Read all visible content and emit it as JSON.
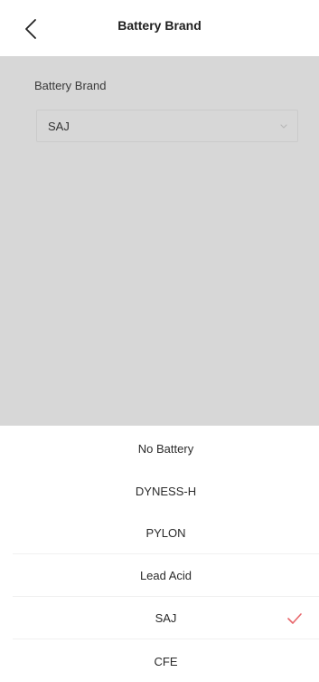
{
  "header": {
    "title": "Battery Brand",
    "back_icon": "chevron-left-icon"
  },
  "form": {
    "label": "Battery Brand",
    "selected_value": "SAJ",
    "chevron_icon": "chevron-down-icon"
  },
  "picker": {
    "options": [
      {
        "label": "No Battery"
      },
      {
        "label": "DYNESS-H"
      },
      {
        "label": "PYLON"
      },
      {
        "label": "Lead Acid"
      },
      {
        "label": "SAJ",
        "selected": true
      },
      {
        "label": "CFE"
      }
    ],
    "check_icon": "checkmark-icon",
    "check_color": "#e8666b"
  },
  "colors": {
    "overlay": "#d7d7d7",
    "background": "#ffffff"
  }
}
